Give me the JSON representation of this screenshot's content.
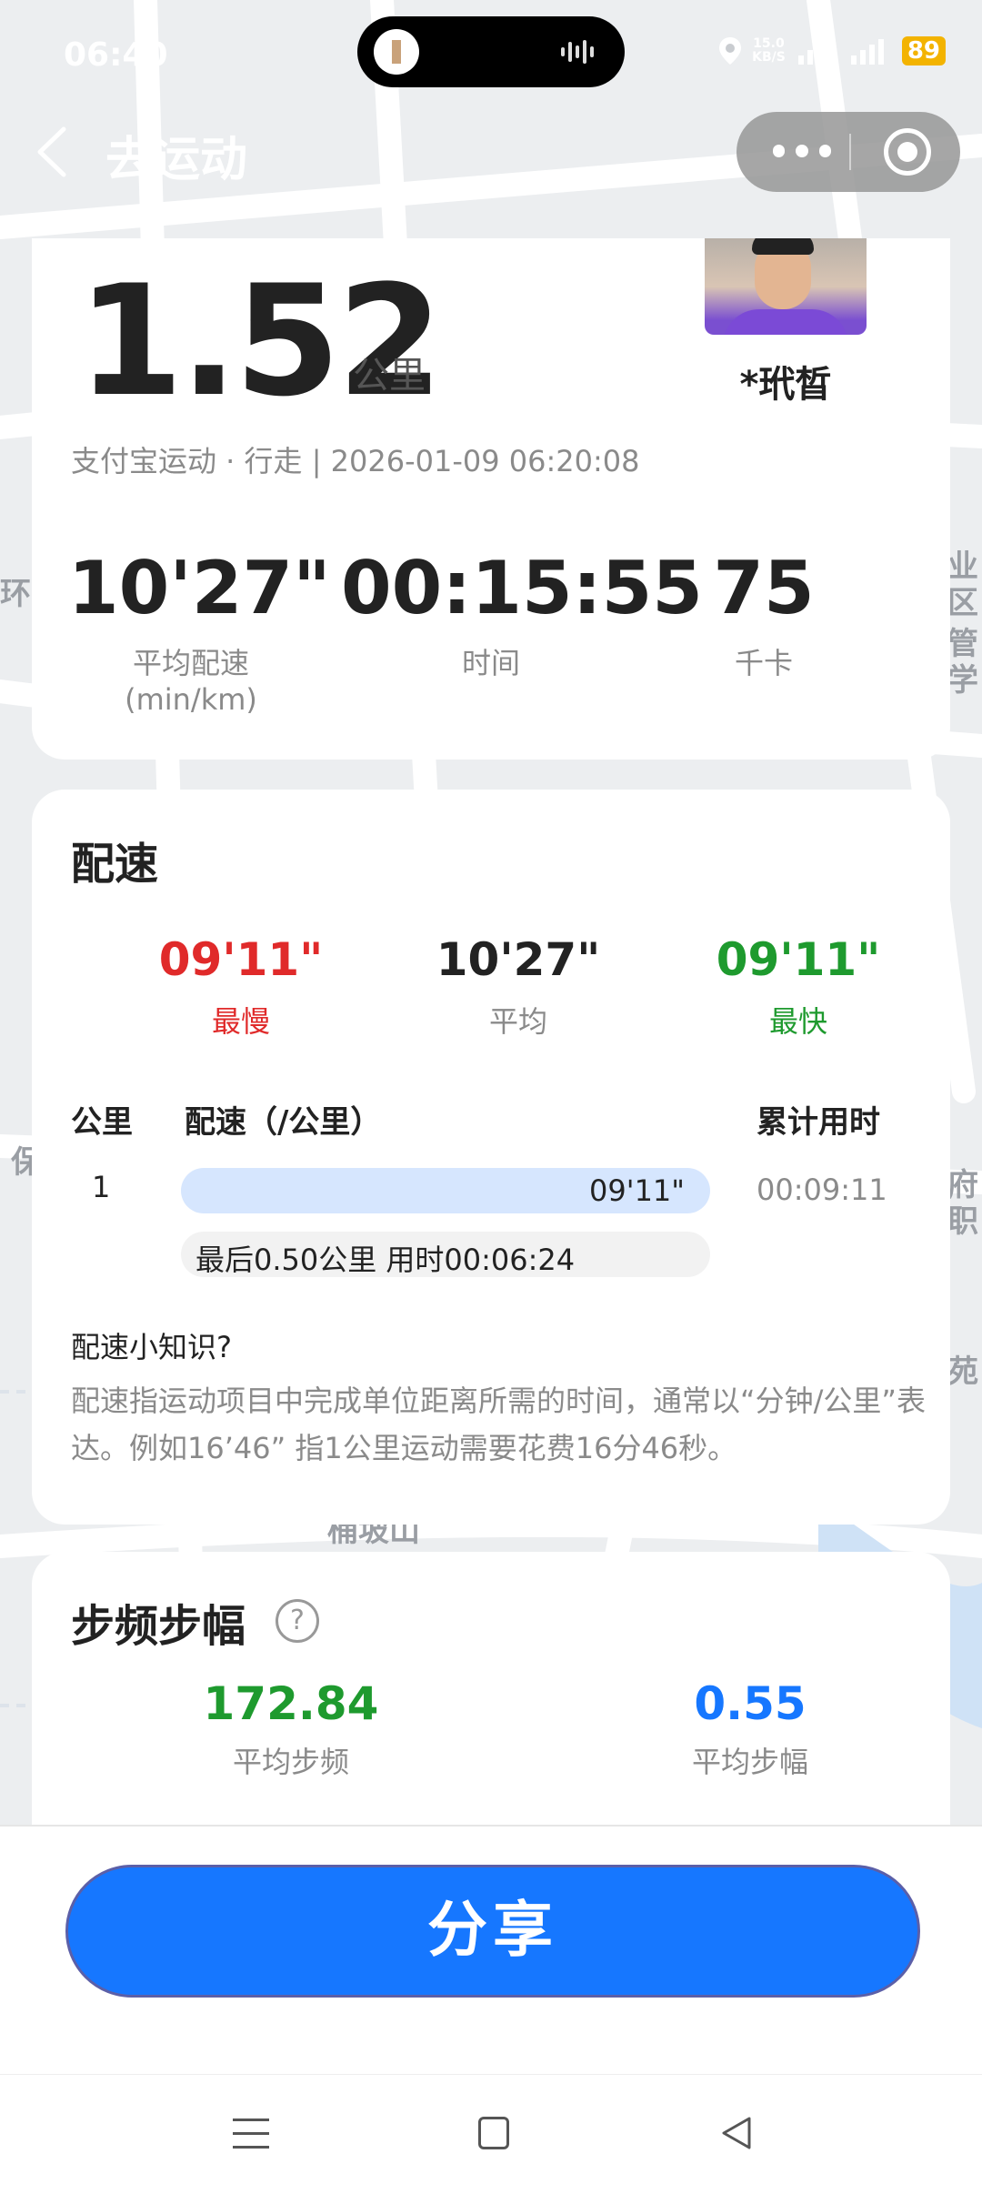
{
  "status_bar": {
    "time": "06:40",
    "net_speed_value": "15.0",
    "net_speed_unit": "KB/S",
    "battery": "89"
  },
  "header": {
    "title": "去运动"
  },
  "map": {
    "labels": [
      "环",
      "业",
      "区",
      "管",
      "学",
      "保",
      "府",
      "职",
      "苑",
      "桶坡山"
    ]
  },
  "summary": {
    "distance": "1.52",
    "distance_unit": "公里",
    "username": "*玳晳",
    "meta": "支付宝运动 · 行走 | 2026-01-09 06:20:08",
    "stats": [
      {
        "value": "10'27\"",
        "label": "平均配速(min/km)"
      },
      {
        "value": "00:15:55",
        "label": "时间"
      },
      {
        "value": "75",
        "label": "千卡"
      }
    ]
  },
  "pace": {
    "title": "配速",
    "slowest": {
      "value": "09'11\"",
      "label": "最慢"
    },
    "average": {
      "value": "10'27\"",
      "label": "平均"
    },
    "fastest": {
      "value": "09'11\"",
      "label": "最快"
    },
    "table_headers": {
      "km": "公里",
      "pace": "配速（/公里）",
      "cumulative": "累计用时"
    },
    "rows": [
      {
        "km": "1",
        "pace": "09'11\"",
        "cumulative": "00:09:11"
      }
    ],
    "last_segment": "最后0.50公里 用时00:06:24",
    "tip_title": "配速小知识?",
    "tip_body": "配速指运动项目中完成单位距离所需的时间，通常以“分钟/公里”表达。例如16’46” 指1公里运动需要花费16分46秒。"
  },
  "cadence": {
    "title": "步频步幅",
    "help_icon": "?",
    "frequency": {
      "value": "172.84",
      "label": "平均步频"
    },
    "stride": {
      "value": "0.55",
      "label": "平均步幅"
    }
  },
  "footer": {
    "share_label": "分享"
  },
  "colors": {
    "accent_blue": "#1677ff",
    "slow_red": "#e02a2a",
    "fast_green": "#1e9a2e",
    "battery_yellow": "#f3b300"
  }
}
